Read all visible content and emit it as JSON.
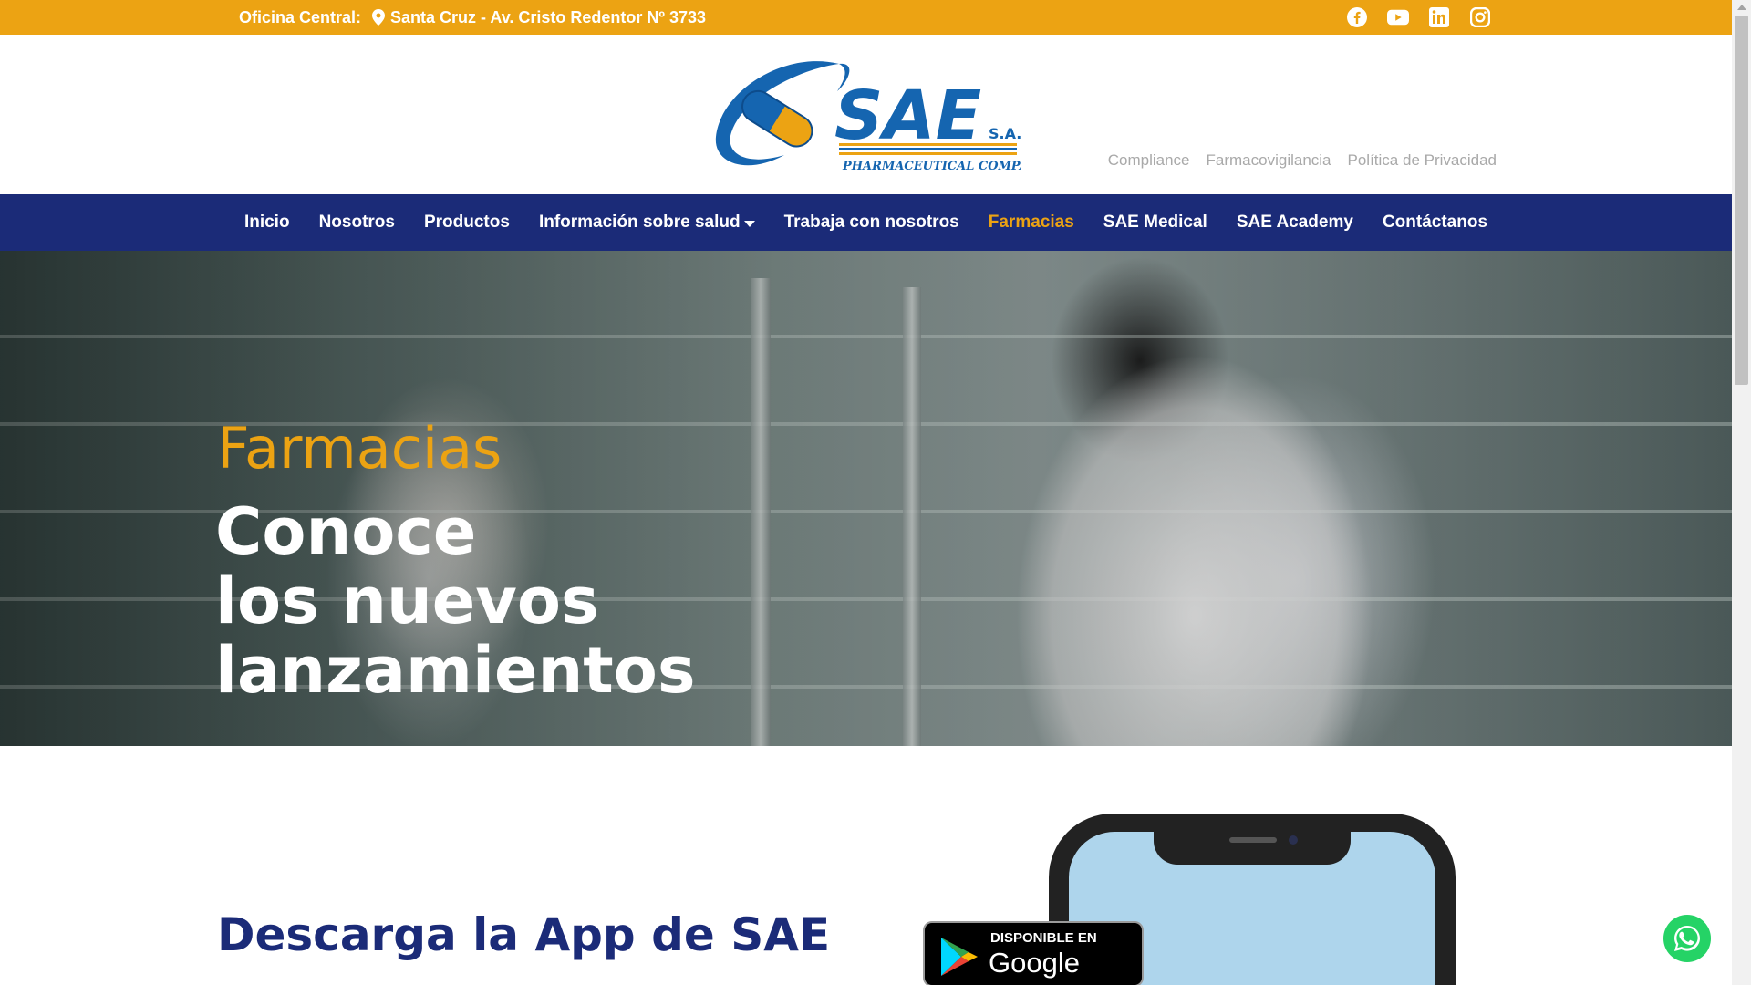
{
  "topbar": {
    "address_label": "Oficina Central:",
    "address": "Santa Cruz - Av. Cristo Redentor Nº 3733",
    "social": [
      "facebook-icon",
      "youtube-icon",
      "linkedin-icon",
      "instagram-icon"
    ],
    "background": "#ECA313"
  },
  "logo": {
    "brand": "SAE",
    "suffix": "S.A.",
    "tagline": "PHARMACEUTICAL COMPANY"
  },
  "utility_links": [
    "Compliance",
    "Farmacovigilancia",
    "Política de Privacidad"
  ],
  "nav": {
    "items": [
      {
        "label": "Inicio"
      },
      {
        "label": "Nosotros"
      },
      {
        "label": "Productos"
      },
      {
        "label": "Información sobre salud"
      },
      {
        "label": "Trabaja con nosotros"
      },
      {
        "label": "Farmacias"
      },
      {
        "label": "SAE Medical"
      },
      {
        "label": "SAE Academy"
      },
      {
        "label": "Contáctanos"
      }
    ],
    "active": "Farmacias",
    "background": "#1B2B78",
    "accent": "#ECA313"
  },
  "hero": {
    "title": "Farmacias",
    "subtitle_lines": [
      "Conoce",
      "los nuevos",
      "lanzamientos"
    ]
  },
  "download": {
    "title": "Descarga la App de SAE",
    "badge_small": "DISPONIBLE EN",
    "badge_big": "Google Play"
  },
  "whatsapp": {
    "icon": "whatsapp-icon",
    "color": "#25D366"
  }
}
